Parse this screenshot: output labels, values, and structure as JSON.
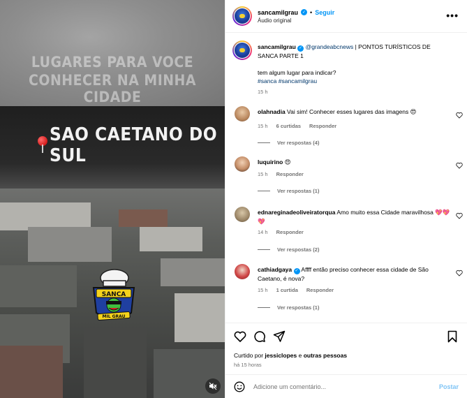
{
  "media": {
    "overlay_line1": "LUGARES PARA VOCE",
    "overlay_line2": "CONHECER NA MINHA CIDADE",
    "city_label": "SAO CAETANO DO SUL",
    "mascot_text_top": "SANCA",
    "mascot_text_bottom": "MIL GRAU"
  },
  "header": {
    "username": "sancamilgrau",
    "separator": "•",
    "follow_label": "Seguir",
    "audio_label": "Áudio original",
    "more_label": "•••"
  },
  "caption": {
    "username": "sancamilgrau",
    "mention": "@grandeabcnews",
    "text": " | PONTOS TURÍSTICOS DE SANCA PARTE 1",
    "question": "tem algum lugar para indicar?",
    "hashtags": "#sanca #sancamilgrau",
    "time": "15 h"
  },
  "comments": [
    {
      "username": "olahnadia",
      "text": " Vai sim! Conhecer esses lugares das imagens 😍",
      "time": "15 h",
      "likes": "6 curtidas",
      "reply": "Responder",
      "replies": "Ver respostas (4)"
    },
    {
      "username": "luquirino",
      "text": " 😍",
      "time": "15 h",
      "likes": "",
      "reply": "Responder",
      "replies": "Ver respostas (1)"
    },
    {
      "username": "ednareginadeoliveiratorqua",
      "text": " Amo muito essa Cidade maravilhosa 💖💖💖",
      "time": "14 h",
      "likes": "",
      "reply": "Responder",
      "replies": "Ver respostas (2)"
    },
    {
      "username": "cathiadgaya",
      "text": " Affff então preciso conhecer essa cidade de São Caetano, é nova?",
      "time": "15 h",
      "likes": "1 curtida",
      "reply": "Responder",
      "replies": "Ver respostas (1)"
    }
  ],
  "footer": {
    "liked_prefix": "Curtido por ",
    "liked_user": "jessiclopes",
    "liked_suffix": " e ",
    "liked_others": "outras pessoas",
    "time_ago": "há 15 horas",
    "add_comment_placeholder": "Adicione um comentário...",
    "post_label": "Postar"
  },
  "colors": {
    "accent": "#0095f6",
    "link": "#00376b",
    "muted": "#737373"
  }
}
